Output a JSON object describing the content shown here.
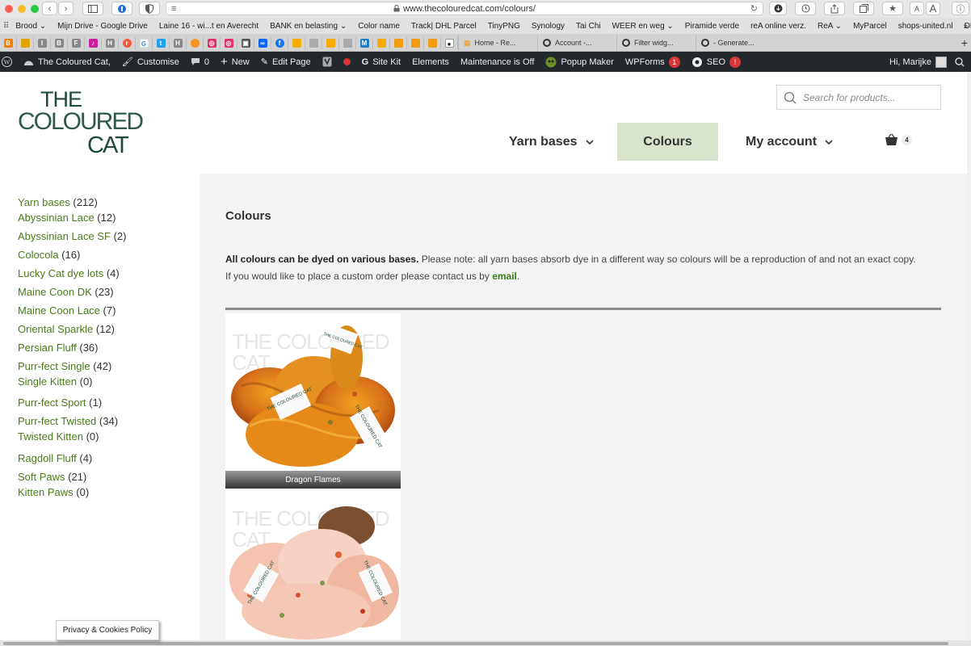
{
  "browser": {
    "url": "www.thecolouredcat.com/colours/",
    "text_size_small": "A",
    "text_size_large": "A",
    "bookmarks": [
      "Brood ⌄",
      "Mijn Drive - Google Drive",
      "Laine 16 - wi...t en Averecht",
      "BANK en belasting ⌄",
      "Color name",
      "Track| DHL Parcel",
      "TinyPNG",
      "Synology",
      "Tai Chi",
      "WEER en weg ⌄",
      "Piramide verde",
      "reA online verz.",
      "ReA ⌄",
      "MyParcel",
      "shops-united.nl",
      "DHL Account"
    ],
    "overflow": "»",
    "pinned_tab_icons": [
      "blogger",
      "square",
      "I",
      "B",
      "F",
      "J",
      "H",
      "r",
      "G",
      "twitter",
      "H",
      "dot",
      "insta",
      "insta",
      "box",
      "meta",
      "fb",
      "chart",
      "link",
      "chart",
      "grid",
      "link",
      "M",
      "chart",
      "grid",
      "grid",
      "panda"
    ],
    "tabs": [
      "Home - Re...",
      "Account -...",
      "Filter widg...",
      "- Generate..."
    ],
    "new_tab": "+"
  },
  "admin_bar": {
    "site": "The Coloured Cat,",
    "customise": "Customise",
    "comments": "0",
    "new": "New",
    "edit_page": "Edit Page",
    "site_kit": "Site Kit",
    "elements": "Elements",
    "maintenance": "Maintenance is Off",
    "popup_maker": "Popup Maker",
    "wpforms": "WPForms",
    "wpforms_badge": "1",
    "seo": "SEO",
    "seo_badge": "!",
    "greeting": "Hi, Marijke"
  },
  "header": {
    "logo_line1": "THE",
    "logo_line2": "COLOURED",
    "logo_line3": "CAT",
    "search_placeholder": "Search for products...",
    "nav": {
      "yarn_bases": "Yarn bases",
      "colours": "Colours",
      "my_account": "My account"
    },
    "cart_count": "4"
  },
  "sidebar": {
    "categories": [
      {
        "name": "Yarn bases",
        "count": "(212)"
      },
      {
        "name": "Abyssinian Lace",
        "count": "(12)"
      },
      {
        "name": "Abyssinian Lace SF",
        "count": "(2)"
      },
      {
        "name": "Colocola",
        "count": "(16)"
      },
      {
        "name": "Lucky Cat dye lots",
        "count": "(4)"
      },
      {
        "name": "Maine Coon DK",
        "count": "(23)"
      },
      {
        "name": "Maine Coon Lace",
        "count": "(7)"
      },
      {
        "name": "Oriental Sparkle",
        "count": "(12)"
      },
      {
        "name": "Persian Fluff",
        "count": "(36)"
      },
      {
        "name": "Purr-fect Single",
        "count": "(42)"
      },
      {
        "name": "Single Kitten",
        "count": "(0)"
      },
      {
        "name": "Purr-fect Sport",
        "count": "(1)"
      },
      {
        "name": "Purr-fect Twisted",
        "count": "(34)"
      },
      {
        "name": "Twisted Kitten",
        "count": "(0)"
      },
      {
        "name": "Ragdoll Fluff",
        "count": "(4)"
      },
      {
        "name": "Soft Paws",
        "count": "(21)"
      },
      {
        "name": "Kitten Paws",
        "count": "(0)"
      }
    ]
  },
  "main": {
    "title": "Colours",
    "intro_bold": "All colours can be dyed on various bases.",
    "intro_text": " Please note: all yarn bases absorb dye in a different way so colours will be a reproduction of and not an exact copy.",
    "intro_line2": "If you would like to place a custom order please contact us by ",
    "email_link": "email",
    "period": ".",
    "products": [
      {
        "caption": "Dragon Flames",
        "watermark": "THE COLOURED CAT"
      },
      {
        "caption": "",
        "watermark": "THE COLOURED CAT"
      }
    ],
    "skein_label": "THE COLOURED CAT"
  },
  "privacy_label": "Privacy & Cookies Policy",
  "colors": {
    "admin_bar": "#23282d",
    "link_green": "#4a7a1a",
    "active_nav": "#d9e4cf",
    "logo_green": "#1f4a3a"
  }
}
